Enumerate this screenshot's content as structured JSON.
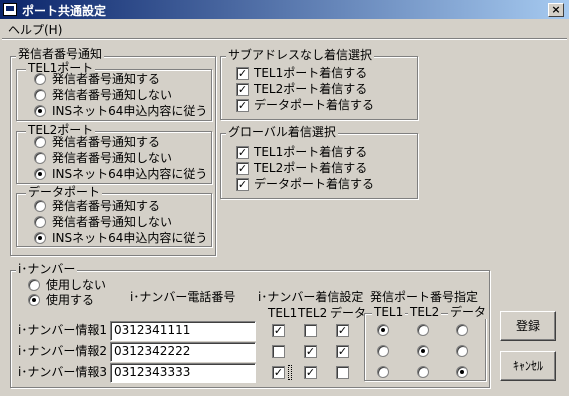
{
  "window": {
    "title": "ポート共通設定",
    "close_label": "×"
  },
  "menu": {
    "help": "ヘルプ(H)"
  },
  "caller_id": {
    "title": "発信者番号通知",
    "groups": [
      {
        "title": "TEL1ポート",
        "options": [
          "発信者番号通知する",
          "発信者番号通知しない",
          "INSネット64申込内容に従う"
        ],
        "selected": 2
      },
      {
        "title": "TEL2ポート",
        "options": [
          "発信者番号通知する",
          "発信者番号通知しない",
          "INSネット64申込内容に従う"
        ],
        "selected": 2
      },
      {
        "title": "データポート",
        "options": [
          "発信者番号通知する",
          "発信者番号通知しない",
          "INSネット64申込内容に従う"
        ],
        "selected": 2
      }
    ]
  },
  "subaddress": {
    "title": "サブアドレスなし着信選択",
    "items": [
      {
        "label": "TEL1ポート着信する",
        "checked": true
      },
      {
        "label": "TEL2ポート着信する",
        "checked": true
      },
      {
        "label": "データポート着信する",
        "checked": true
      }
    ]
  },
  "global": {
    "title": "グローバル着信選択",
    "items": [
      {
        "label": "TEL1ポート着信する",
        "checked": true
      },
      {
        "label": "TEL2ポート着信する",
        "checked": true
      },
      {
        "label": "データポート着信する",
        "checked": true
      }
    ]
  },
  "inumber": {
    "title": "i･ナンバー",
    "use_options": [
      "使用しない",
      "使用する"
    ],
    "use_selected": 1,
    "col_phone": "i･ナンバー電話番号",
    "col_incoming": "i･ナンバー着信設定",
    "col_port": "発信ポート番号指定",
    "sub_incoming": [
      "TEL1",
      "TEL2",
      "データ"
    ],
    "sub_port": [
      "TEL1",
      "TEL2",
      "データ"
    ],
    "rows": [
      {
        "label": "i･ナンバー情報1",
        "phone": "0312341111",
        "incoming": [
          true,
          false,
          true
        ],
        "port": 0
      },
      {
        "label": "i･ナンバー情報2",
        "phone": "0312342222",
        "incoming": [
          false,
          true,
          true
        ],
        "port": 1
      },
      {
        "label": "i･ナンバー情報3",
        "phone": "0312343333",
        "incoming": [
          true,
          true,
          false
        ],
        "port": 2
      }
    ]
  },
  "buttons": {
    "register": "登録",
    "cancel": "ｷｬﾝｾﾙ"
  }
}
